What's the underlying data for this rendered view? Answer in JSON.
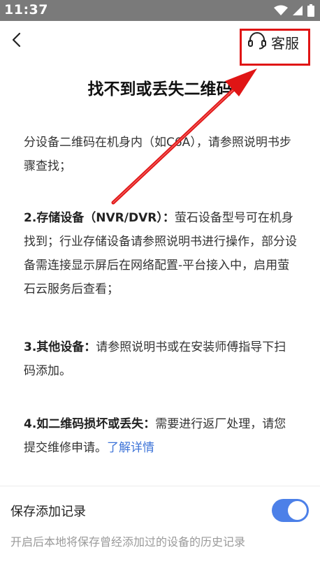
{
  "status_bar": {
    "time": "11:37",
    "icons": [
      "wifi-icon",
      "cellular-signal-icon",
      "battery-icon"
    ]
  },
  "header": {
    "back_icon": "chevron-left-icon",
    "service_icon": "headset-icon",
    "service_label": "客服"
  },
  "page": {
    "title": "找不到或丢失二维码",
    "paragraphs": [
      {
        "text": "分设备二维码在机身内（如C6A），请参照说明书步骤查找；"
      },
      {
        "heading": "2.存储设备（NVR/DVR）：",
        "text": "萤石设备型号可在机身找到；行业存储设备请参照说明书进行操作，部分设备需连接显示屏后在网络配置-平台接入中，启用萤石云服务后查看；"
      },
      {
        "heading": "3.其他设备：",
        "text": "请参照说明书或在安装师傅指导下扫码添加。"
      },
      {
        "heading": "4.如二维码损坏或丢失：",
        "text": "需要进行返厂处理，请您提交维修申请。",
        "link": "了解详情"
      }
    ]
  },
  "settings": {
    "save_record_label": "保存添加记录",
    "save_record_desc": "开启后本地将保存曾经添加过的设备的历史记录",
    "save_record_enabled": true
  },
  "colors": {
    "status_bar": "#7a7a7a",
    "accent": "#4c80e8",
    "link": "#3e74d8",
    "annotation": "#e01515"
  }
}
